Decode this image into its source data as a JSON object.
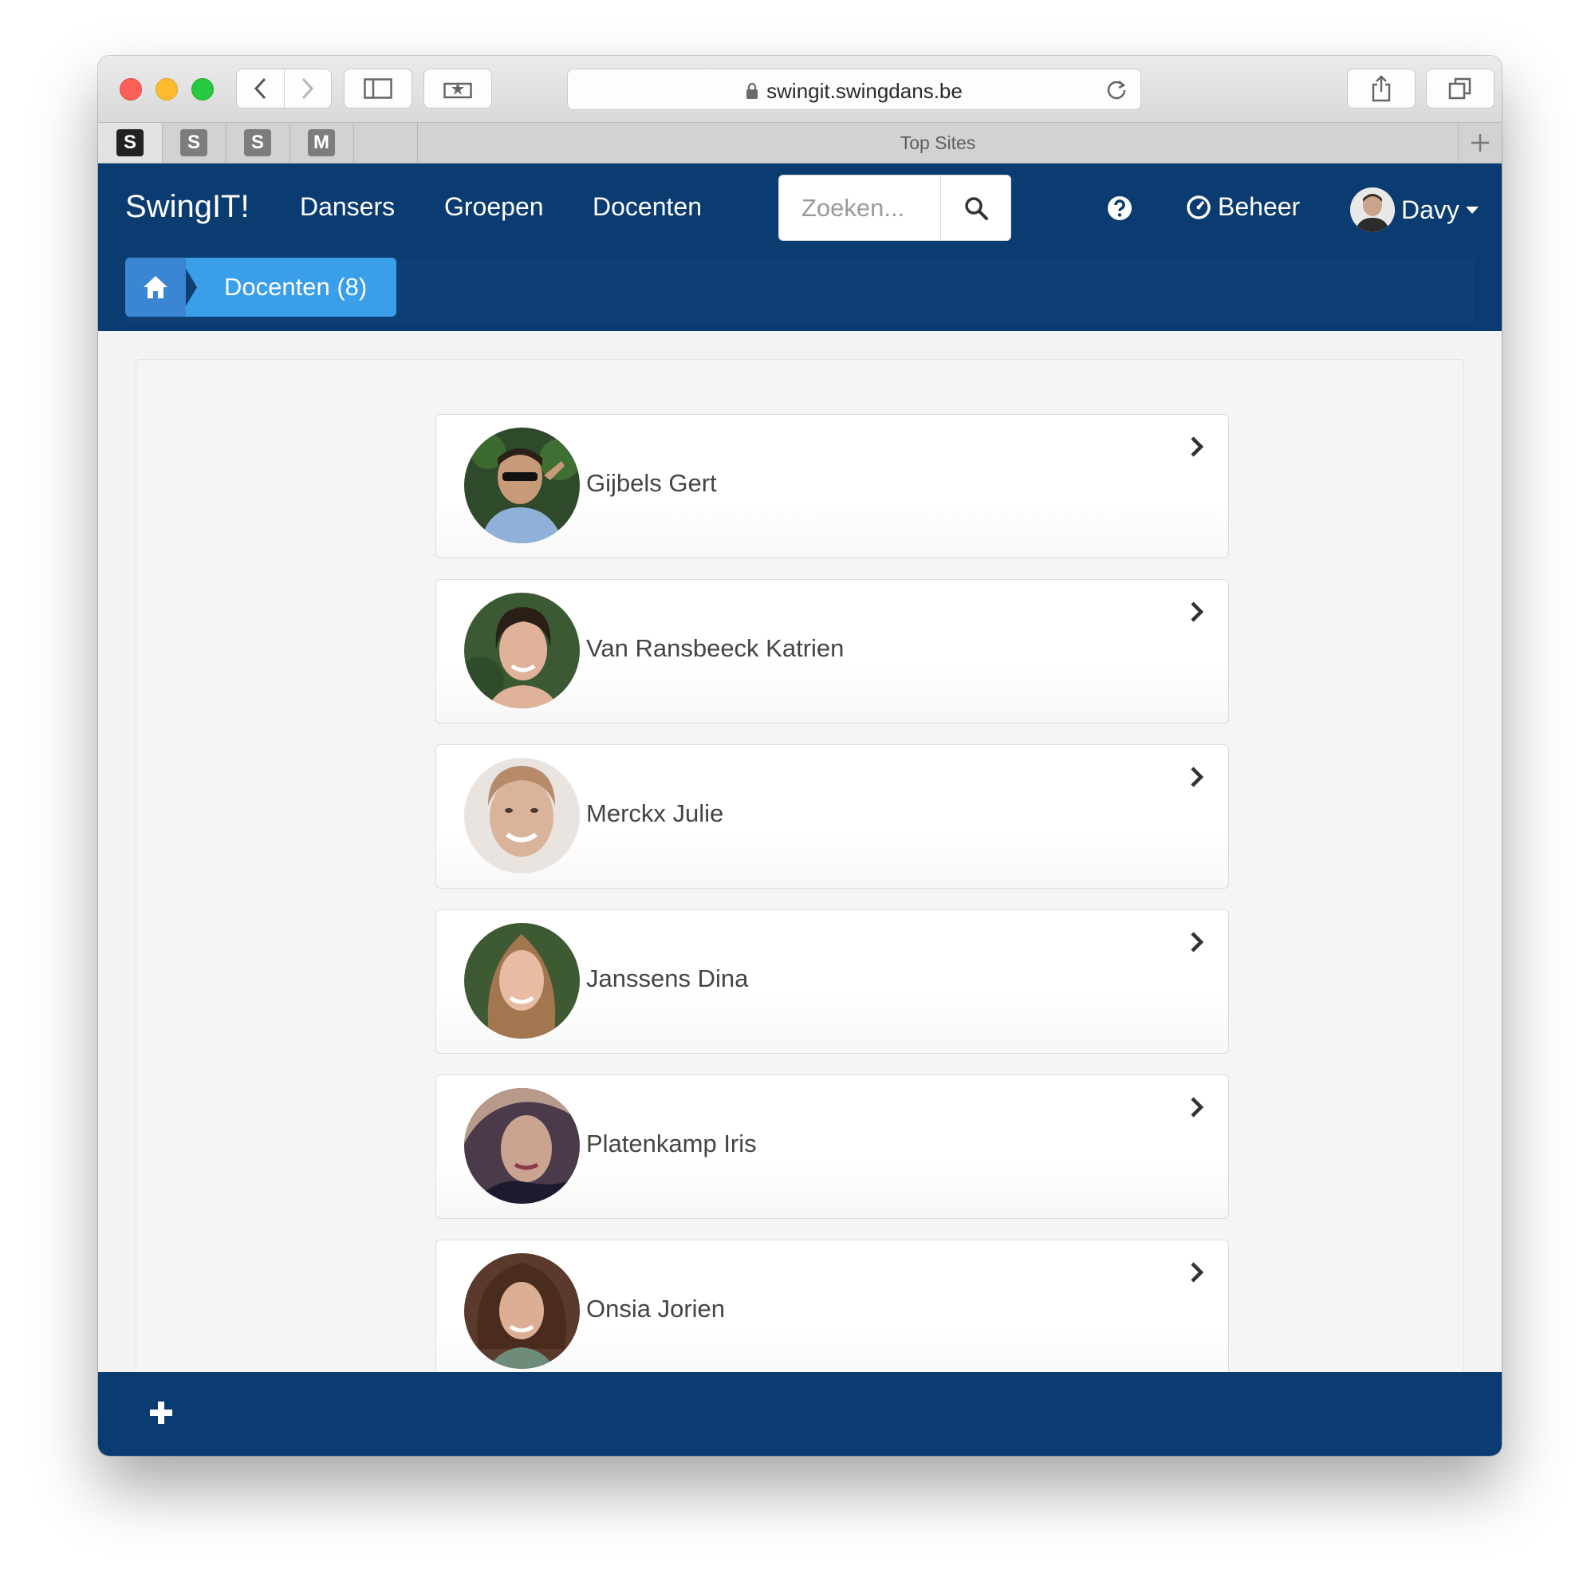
{
  "browser": {
    "url": "swingit.swingdans.be",
    "favorites": [
      {
        "letter": "S"
      },
      {
        "letter": "S"
      },
      {
        "letter": "S"
      },
      {
        "letter": "M"
      }
    ],
    "top_sites_label": "Top Sites"
  },
  "navbar": {
    "brand": "SwingIT!",
    "links": [
      "Dansers",
      "Groepen",
      "Docenten"
    ],
    "search_placeholder": "Zoeken...",
    "beheer_label": "Beheer",
    "user_name": "Davy"
  },
  "breadcrumb": {
    "current": "Docenten (8)"
  },
  "teachers": [
    {
      "name": "Gijbels Gert",
      "photo_color": "#2f4a2a"
    },
    {
      "name": "Van Ransbeeck Katrien",
      "photo_color": "#3b5a34"
    },
    {
      "name": "Merckx Julie",
      "photo_color": "#d9b49b"
    },
    {
      "name": "Janssens Dina",
      "photo_color": "#3d5a33"
    },
    {
      "name": "Platenkamp Iris",
      "photo_color": "#4a3a4a"
    },
    {
      "name": "Onsia Jorien",
      "photo_color": "#5a3a2c"
    }
  ],
  "colors": {
    "navbar": "#0b3c71",
    "breadcrumb_active": "#3a9ee9",
    "breadcrumb_home": "#3b86d2"
  }
}
